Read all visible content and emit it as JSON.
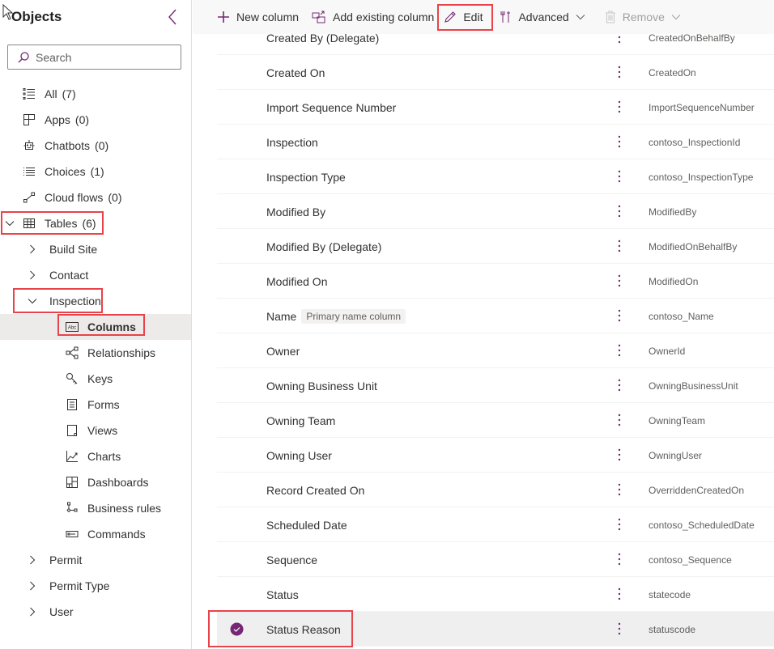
{
  "sidebar": {
    "title": "Objects",
    "search_placeholder": "Search",
    "items": [
      {
        "label": "All",
        "count": "(7)",
        "icon": "list-icon"
      },
      {
        "label": "Apps",
        "count": "(0)",
        "icon": "apps-icon"
      },
      {
        "label": "Chatbots",
        "count": "(0)",
        "icon": "bot-icon"
      },
      {
        "label": "Choices",
        "count": "(1)",
        "icon": "choices-icon"
      },
      {
        "label": "Cloud flows",
        "count": "(0)",
        "icon": "flow-icon"
      },
      {
        "label": "Tables",
        "count": "(6)",
        "icon": "table-icon",
        "expanded": true
      }
    ],
    "tables": [
      {
        "label": "Build Site",
        "expanded": false
      },
      {
        "label": "Contact",
        "expanded": false
      },
      {
        "label": "Inspection",
        "expanded": true
      },
      {
        "label": "Permit",
        "expanded": false
      },
      {
        "label": "Permit Type",
        "expanded": false
      },
      {
        "label": "User",
        "expanded": false
      }
    ],
    "inspection_children": [
      {
        "label": "Columns",
        "icon": "abc-icon",
        "selected": true
      },
      {
        "label": "Relationships",
        "icon": "relationships-icon"
      },
      {
        "label": "Keys",
        "icon": "key-icon"
      },
      {
        "label": "Forms",
        "icon": "form-icon"
      },
      {
        "label": "Views",
        "icon": "view-icon"
      },
      {
        "label": "Charts",
        "icon": "chart-icon"
      },
      {
        "label": "Dashboards",
        "icon": "dashboard-icon"
      },
      {
        "label": "Business rules",
        "icon": "business-rule-icon"
      },
      {
        "label": "Commands",
        "icon": "command-icon"
      }
    ]
  },
  "toolbar": {
    "new_column": "New column",
    "add_existing": "Add existing column",
    "edit": "Edit",
    "advanced": "Advanced",
    "remove": "Remove"
  },
  "columns": [
    {
      "display": "Created By (Delegate)",
      "logical": "CreatedOnBehalfBy"
    },
    {
      "display": "Created On",
      "logical": "CreatedOn"
    },
    {
      "display": "Import Sequence Number",
      "logical": "ImportSequenceNumber"
    },
    {
      "display": "Inspection",
      "logical": "contoso_InspectionId"
    },
    {
      "display": "Inspection Type",
      "logical": "contoso_InspectionType"
    },
    {
      "display": "Modified By",
      "logical": "ModifiedBy"
    },
    {
      "display": "Modified By (Delegate)",
      "logical": "ModifiedOnBehalfBy"
    },
    {
      "display": "Modified On",
      "logical": "ModifiedOn"
    },
    {
      "display": "Name",
      "badge": "Primary name column",
      "logical": "contoso_Name"
    },
    {
      "display": "Owner",
      "logical": "OwnerId"
    },
    {
      "display": "Owning Business Unit",
      "logical": "OwningBusinessUnit"
    },
    {
      "display": "Owning Team",
      "logical": "OwningTeam"
    },
    {
      "display": "Owning User",
      "logical": "OwningUser"
    },
    {
      "display": "Record Created On",
      "logical": "OverriddenCreatedOn"
    },
    {
      "display": "Scheduled Date",
      "logical": "contoso_ScheduledDate"
    },
    {
      "display": "Sequence",
      "logical": "contoso_Sequence"
    },
    {
      "display": "Status",
      "logical": "statecode"
    },
    {
      "display": "Status Reason",
      "logical": "statuscode",
      "selected": true
    }
  ],
  "colors": {
    "accent": "#742774",
    "highlight_box": "#e8434a",
    "selected_bg": "#edebe9"
  }
}
